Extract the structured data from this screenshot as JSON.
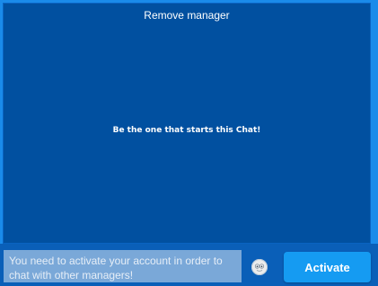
{
  "chat": {
    "title": "Remove manager",
    "empty_message": "Be the one that starts this Chat!"
  },
  "composer": {
    "notice": "You need to activate your account in order to chat with other managers!",
    "emoji_icon": "smiley-face-icon",
    "activate_label": "Activate"
  },
  "colors": {
    "frame": "#1a8bea",
    "panel": "#0150a0",
    "button": "#159bf2"
  }
}
